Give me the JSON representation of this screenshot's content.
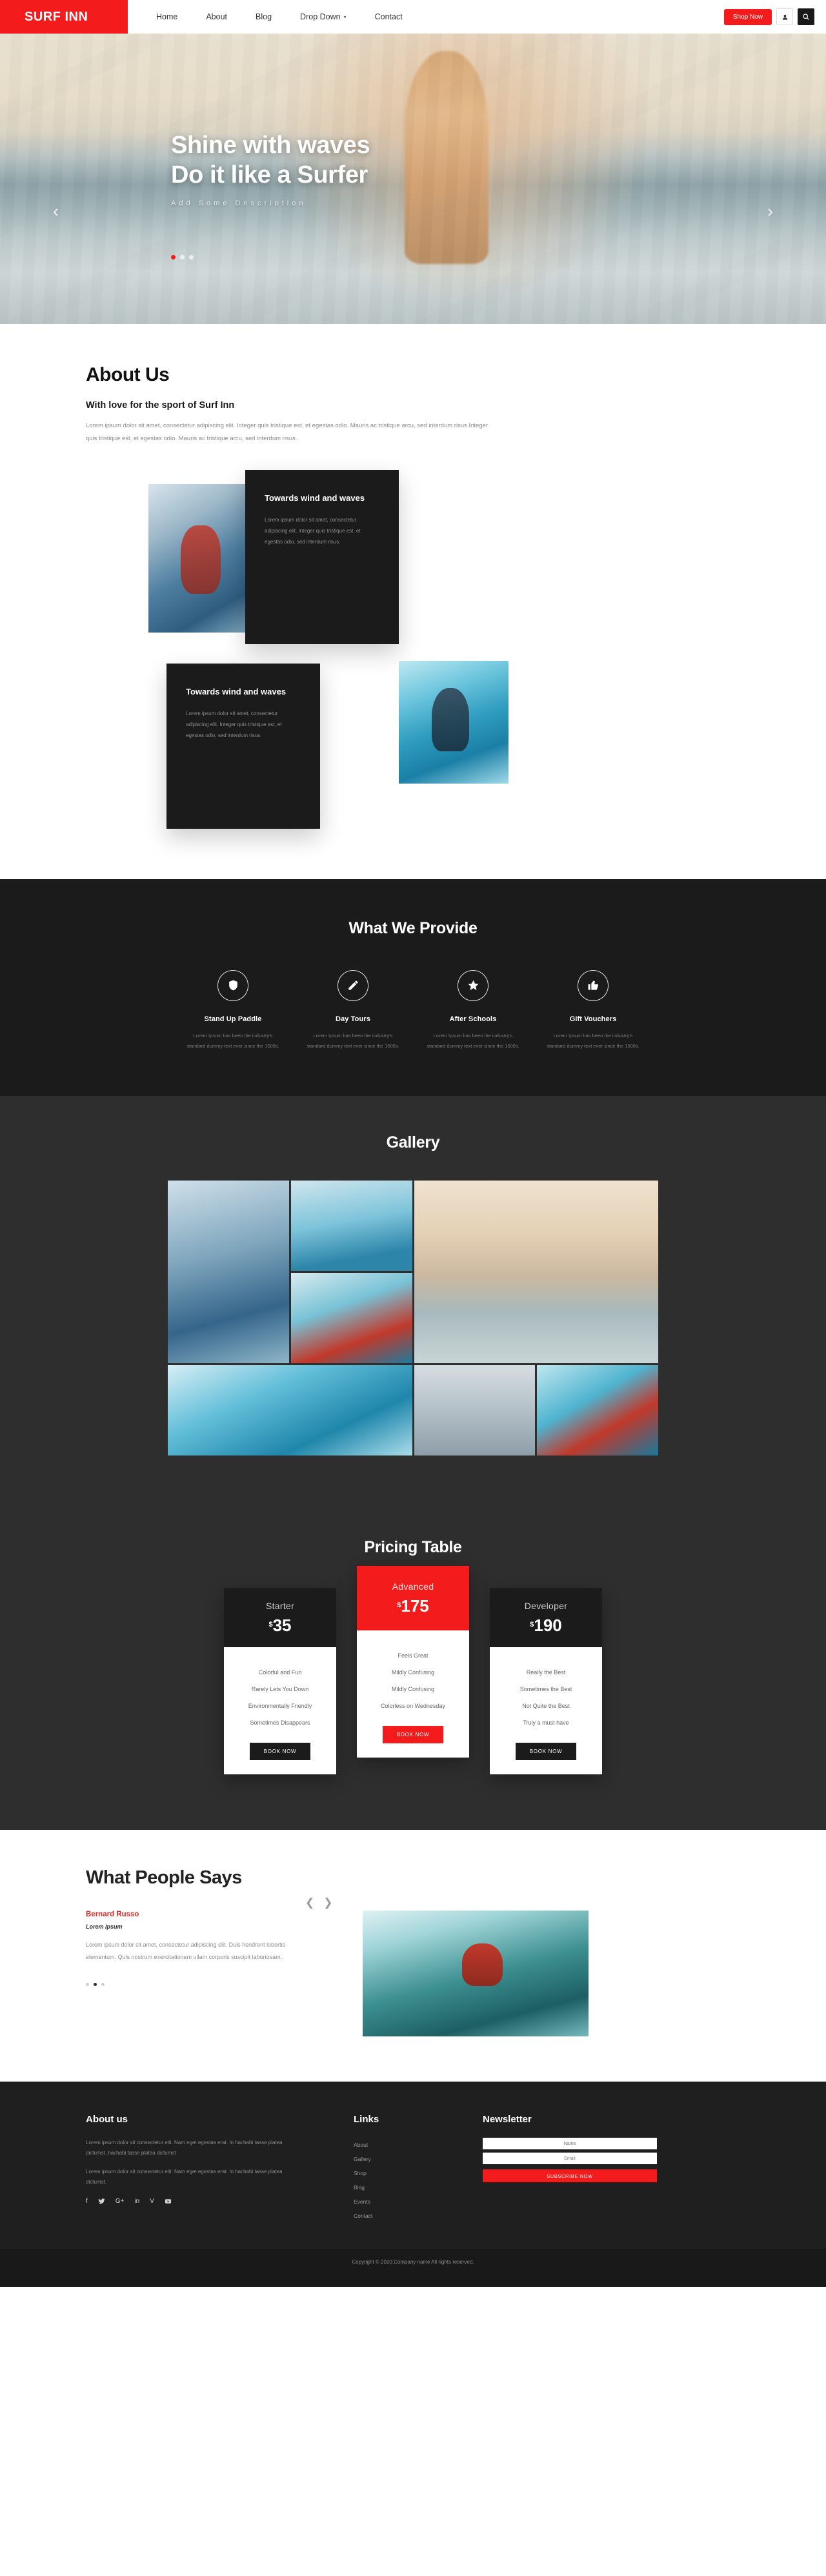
{
  "navbar": {
    "brand": "SURF INN",
    "links": [
      {
        "label": "Home",
        "caret": false
      },
      {
        "label": "About",
        "caret": false
      },
      {
        "label": "Blog",
        "caret": false
      },
      {
        "label": "Drop Down",
        "caret": true
      },
      {
        "label": "Contact",
        "caret": false
      }
    ],
    "caret_glyph": "▾",
    "shop_now": "Shop Now",
    "user_icon": "user-icon",
    "search_icon": "search-icon"
  },
  "hero": {
    "title_line1": "Shine with waves",
    "title_line2": "Do it like a Surfer",
    "subtitle": "Add Some Description",
    "prev_glyph": "‹",
    "next_glyph": "›",
    "dots": 3,
    "active_dot": 0
  },
  "about": {
    "title": "About Us",
    "subtitle": "With love for the sport of Surf Inn",
    "lead": "Lorem ipsum dolor sit amet, consectetur adipiscing elit. Integer quis tristique est, et egestas odio. Mauris ac tristique arcu, sed interdum risus.Integer quis tristique est, et egestas odio. Mauris ac tristique arcu, sed interdum risus.",
    "cards": [
      {
        "title": "Towards wind and waves",
        "text": "Lorem ipsum dolor sit amet, consectetur adipiscing elit. Integer quis tristique est, et egestas odio, sed interdum risus."
      },
      {
        "title": "Towards wind and waves",
        "text": "Lorem ipsum dolor sit amet, consectetur adipiscing elit. Integer quis tristique est, et egestas odio, sed interdum risus."
      }
    ]
  },
  "provide": {
    "title": "What We Provide",
    "services": [
      {
        "icon": "shield-icon",
        "title": "Stand Up Paddle",
        "text": "Lorem Ipsum has been the industry's standard dummy text ever since the 1500s."
      },
      {
        "icon": "pencil-icon",
        "title": "Day Tours",
        "text": "Lorem Ipsum has been the industry's standard dummy text ever since the 1500s."
      },
      {
        "icon": "star-icon",
        "title": "After Schools",
        "text": "Lorem Ipsum has been the industry's standard dummy text ever since the 1500s."
      },
      {
        "icon": "thumbs-up-icon",
        "title": "Gift Vouchers",
        "text": "Lorem Ipsum has been the industry's standard dummy text ever since the 1500s."
      }
    ]
  },
  "gallery": {
    "title": "Gallery",
    "items": [
      "gallery-image-1",
      "gallery-image-2",
      "gallery-image-3",
      "gallery-image-4",
      "gallery-image-5",
      "gallery-image-6",
      "gallery-image-7"
    ]
  },
  "pricing": {
    "title": "Pricing Table",
    "currency": "$",
    "plans": [
      {
        "name": "Starter",
        "price": "35",
        "featured": false,
        "features": [
          "Colorful and Fun",
          "Rarely Lets You Down",
          "Environmentally Friendly",
          "Sometimes Disappears"
        ],
        "button": "BOOK NOW"
      },
      {
        "name": "Advanced",
        "price": "175",
        "featured": true,
        "features": [
          "Feels Great",
          "Mildly Confusing",
          "Mildly Confusing",
          "Colorless on Wednesday"
        ],
        "button": "BOOK NOW"
      },
      {
        "name": "Developer",
        "price": "190",
        "featured": false,
        "features": [
          "Really the Best",
          "Sometimes the Best",
          "Not Quite the Best",
          "Truly a must have"
        ],
        "button": "BOOK NOW"
      }
    ]
  },
  "testimonials": {
    "title": "What People Says",
    "prev_glyph": "❮",
    "next_glyph": "❯",
    "name": "Bernard Russo",
    "role": "Lorem Ipsum",
    "text": "Lorem ipsum dolor sit amet, consectetur adipiscing elit. Duis hendrerit lobortis elementum. Quis nostrum exercitationem ullam corporis suscipit laboriosam.",
    "dots": 3,
    "active_dot": 1
  },
  "footer": {
    "about_title": "About us",
    "about_p1": "Lorem ipsum dolor sit consectetur elit. Nam eget egestas erat. In hachabi tasse platea dictumst. hachabi tasse platea dictumst",
    "about_p2": "Lorem ipsum dolor sit consectetur elit. Nam eget egestas erat. In hachabi tasse platea dictumst.",
    "social": [
      "facebook-icon",
      "twitter-icon",
      "google-plus-icon",
      "linkedin-icon",
      "vimeo-icon",
      "youtube-icon"
    ],
    "social_glyphs": [
      "f",
      "🐦",
      "G+",
      "in",
      "V",
      "▶"
    ],
    "links_title": "Links",
    "links": [
      "About",
      "Gallery",
      "Shop",
      "Blog",
      "Events",
      "Contact"
    ],
    "news_title": "Newsletter",
    "name_placeholder": "Name",
    "email_placeholder": "Email",
    "subscribe": "SUBSCRIBE NOW",
    "copyright": "Copyright © 2020.Company name All rights reserved."
  },
  "colors": {
    "accent": "#f31b1b",
    "dark": "#1b1b1b",
    "dark_alt": "#2e2e2e",
    "footer": "#1f1f1f"
  }
}
